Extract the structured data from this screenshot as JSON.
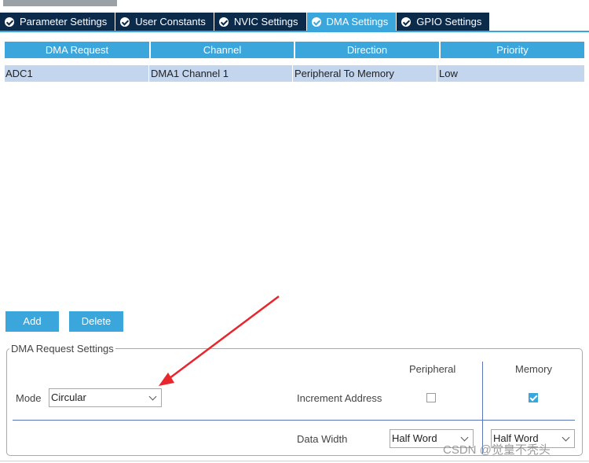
{
  "tabs": [
    {
      "label": "Parameter Settings",
      "active": false
    },
    {
      "label": "User Constants",
      "active": false
    },
    {
      "label": "NVIC Settings",
      "active": false
    },
    {
      "label": "DMA Settings",
      "active": true
    },
    {
      "label": "GPIO Settings",
      "active": false
    }
  ],
  "table": {
    "columns": [
      "DMA Request",
      "Channel",
      "Direction",
      "Priority"
    ],
    "rows": [
      [
        "ADC1",
        "DMA1 Channel 1",
        "Peripheral To Memory",
        "Low"
      ]
    ]
  },
  "buttons": {
    "add": "Add",
    "delete": "Delete"
  },
  "settings": {
    "legend": "DMA Request Settings",
    "col_peripheral": "Peripheral",
    "col_memory": "Memory",
    "mode_label": "Mode",
    "mode_value": "Circular",
    "increment_label": "Increment Address",
    "increment_peripheral": false,
    "increment_memory": true,
    "width_label": "Data Width",
    "width_peripheral": "Half Word",
    "width_memory": "Half Word"
  },
  "watermark": "CSDN @觉皇不秃头",
  "colors": {
    "tab_dark": "#0c2a4a",
    "accent": "#3aa6dc",
    "row_selected": "#c3d6ee",
    "arrow": "#e8262b"
  },
  "icons": {
    "tab": "check-circle-icon",
    "select": "chevron-down-icon",
    "annotation": "red-arrow-icon"
  }
}
